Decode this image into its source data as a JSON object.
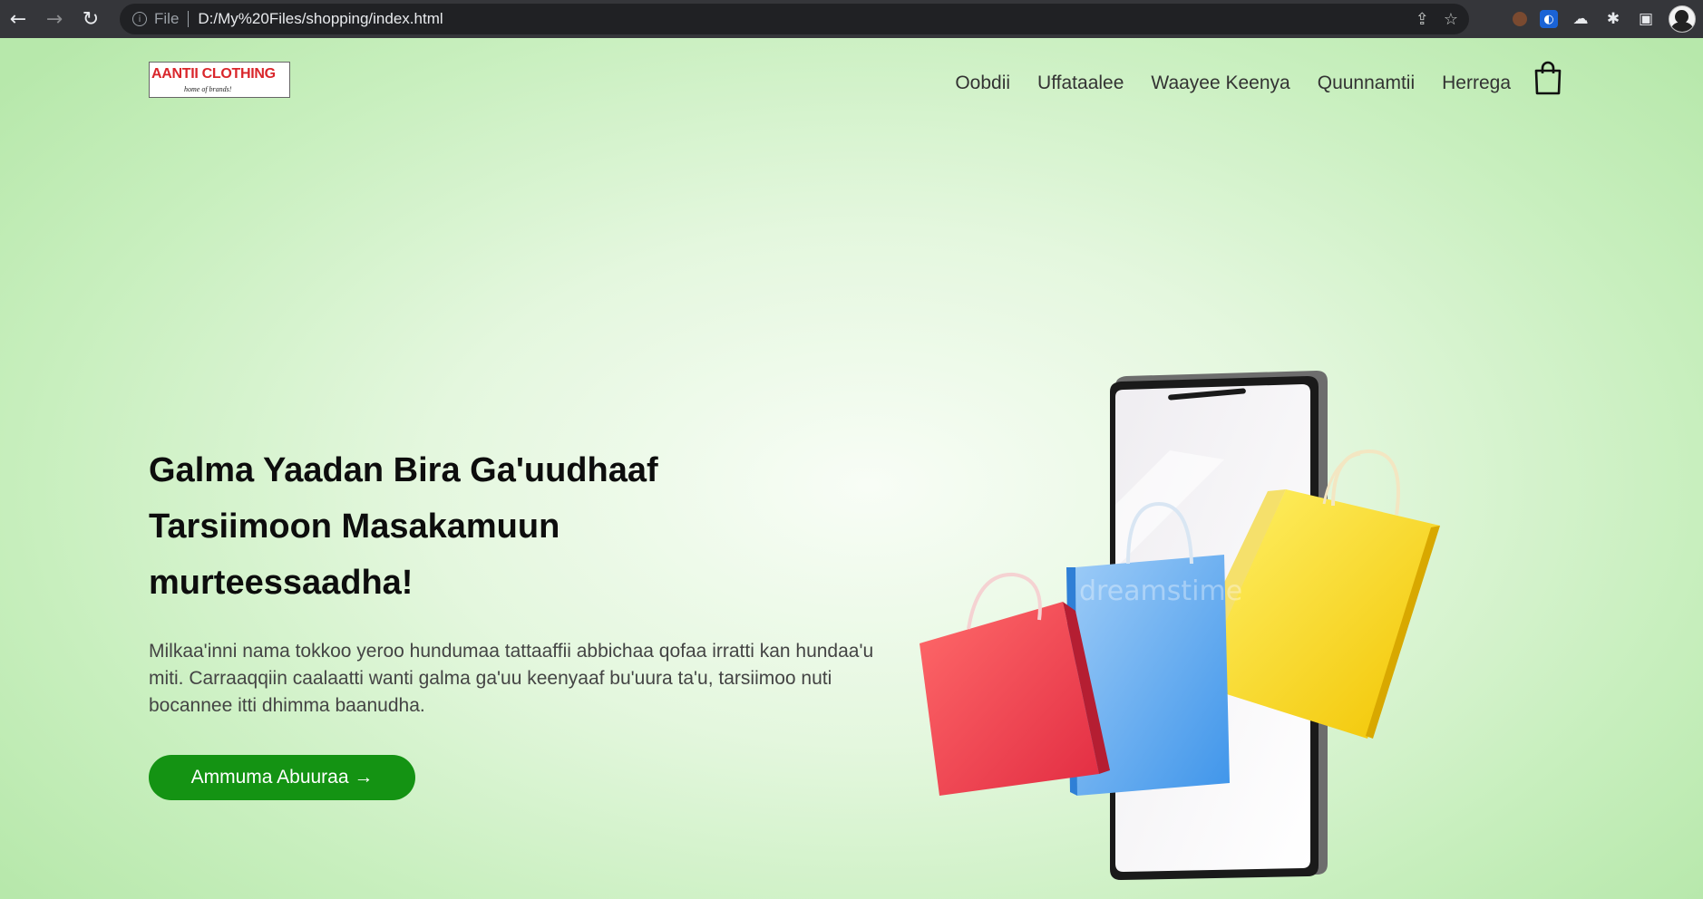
{
  "browser": {
    "back_icon": "arrow-left-icon",
    "forward_icon": "arrow-right-icon",
    "reload_icon": "reload-icon",
    "scheme_label": "File",
    "url": "D:/My%20Files/shopping/index.html"
  },
  "site": {
    "logo_text": "AANTII CLOTHING",
    "logo_tagline": "home of brands!",
    "nav": [
      {
        "label": "Oobdii"
      },
      {
        "label": "Uffataalee"
      },
      {
        "label": "Waayee Keenya"
      },
      {
        "label": "Quunnamtii"
      },
      {
        "label": "Herrega"
      }
    ],
    "cart_icon": "shopping-bag-icon"
  },
  "hero": {
    "headline": "Galma Yaadan Bira Ga'uudhaaf Tarsiimoon Masakamuun murteessaadha!",
    "paragraph": "Milkaa'inni nama tokkoo yeroo hundumaa tattaaffii abbichaa qofaa irratti kan hundaa'u miti. Carraaqqiin caalaatti wanti galma ga'uu keenyaaf bu'uura ta'u, tarsiimoo nuti bocannee itti dhimma baanudha.",
    "cta_label": "Ammuma Abuuraa →",
    "illustration": "phone-with-shopping-bags",
    "watermark": "dreamstime"
  },
  "colors": {
    "accent": "#149313",
    "background": "#c8efbe",
    "logo_red": "#d9262b"
  }
}
